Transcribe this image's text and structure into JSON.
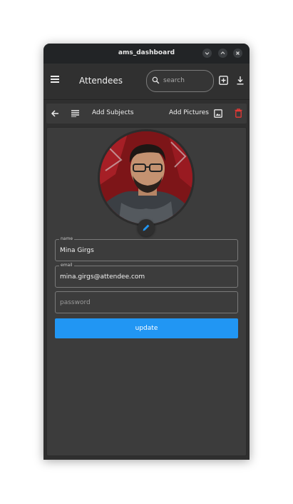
{
  "window": {
    "title": "ams_dashboard"
  },
  "appbar": {
    "title": "Attendees",
    "search": {
      "value": "",
      "placeholder": "search"
    }
  },
  "toolbar": {
    "add_subjects": "Add Subjects",
    "add_pictures": "Add Pictures"
  },
  "form": {
    "name": {
      "label": "name",
      "value": "Mina Girgs"
    },
    "email": {
      "label": "email",
      "value": "mina.girgs@attendee.com"
    },
    "password": {
      "value": "",
      "placeholder": "password"
    },
    "update_label": "update"
  },
  "colors": {
    "accent": "#2196f3",
    "delete": "#e53935",
    "background": "#2f2f2f"
  },
  "icons": [
    "menu-icon",
    "search-icon",
    "add-box-icon",
    "download-icon",
    "back-arrow-icon",
    "notes-icon",
    "photo-icon",
    "trash-icon",
    "edit-pencil-icon"
  ]
}
